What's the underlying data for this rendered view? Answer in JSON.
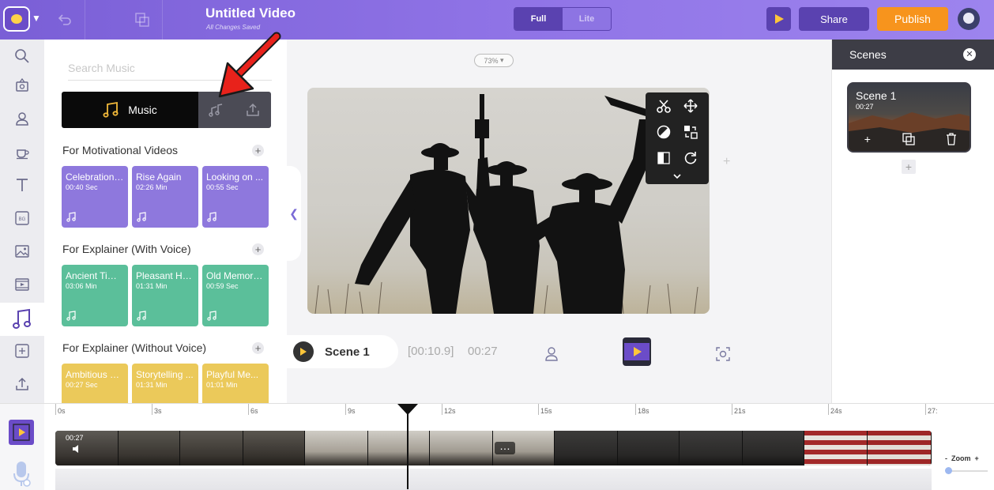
{
  "header": {
    "title": "Untitled Video",
    "subtitle": "All Changes Saved",
    "mode_full": "Full",
    "mode_lite": "Lite",
    "share_label": "Share",
    "publish_label": "Publish"
  },
  "rail": {
    "items": [
      "search-icon",
      "stickers-icon",
      "character-icon",
      "props-icon",
      "text-icon",
      "background-icon",
      "image-icon",
      "video-icon",
      "music-icon",
      "effects-icon",
      "upload-icon"
    ],
    "active": "music-icon"
  },
  "music_panel": {
    "search_placeholder": "Search Music",
    "tab_music_label": "Music",
    "sections": [
      {
        "title": "For Motivational Videos",
        "color": "#8e78dd",
        "tracks": [
          {
            "name": "Celebration ...",
            "duration": "00:40 Sec"
          },
          {
            "name": "Rise Again",
            "duration": "02:26 Min"
          },
          {
            "name": "Looking on ...",
            "duration": "00:55 Sec"
          }
        ]
      },
      {
        "title": "For Explainer (With Voice)",
        "color": "#5bbf9a",
        "tracks": [
          {
            "name": "Ancient Times",
            "duration": "03:06 Min"
          },
          {
            "name": "Pleasant Ha...",
            "duration": "01:31 Min"
          },
          {
            "name": "Old Memories",
            "duration": "00:59 Sec"
          }
        ]
      },
      {
        "title": "For Explainer (Without Voice)",
        "color": "#ebc95a",
        "tracks": [
          {
            "name": "Ambitious D...",
            "duration": "00:27 Sec"
          },
          {
            "name": "Storytelling ...",
            "duration": "01:31 Min"
          },
          {
            "name": "Playful Me...",
            "duration": "01:01 Min"
          }
        ]
      }
    ]
  },
  "canvas": {
    "zoom_level": "73%"
  },
  "scene_controls": {
    "scene_label": "Scene 1",
    "current_time": "[00:10.9]",
    "total_time": "00:27"
  },
  "scenes_panel": {
    "title": "Scenes",
    "scene_card": {
      "title": "Scene 1",
      "duration": "00:27"
    }
  },
  "timeline": {
    "ticks": [
      "0s",
      "3s",
      "6s",
      "9s",
      "12s",
      "15s",
      "18s",
      "21s",
      "24s",
      "27:"
    ],
    "strip_duration": "00:27",
    "zoom_label": "Zoom",
    "zoom_minus": "-",
    "zoom_plus": "+"
  },
  "colors": {
    "accent": "#7a5fd6",
    "publish": "#f7941d",
    "annotation_arrow": "#e8221b"
  }
}
